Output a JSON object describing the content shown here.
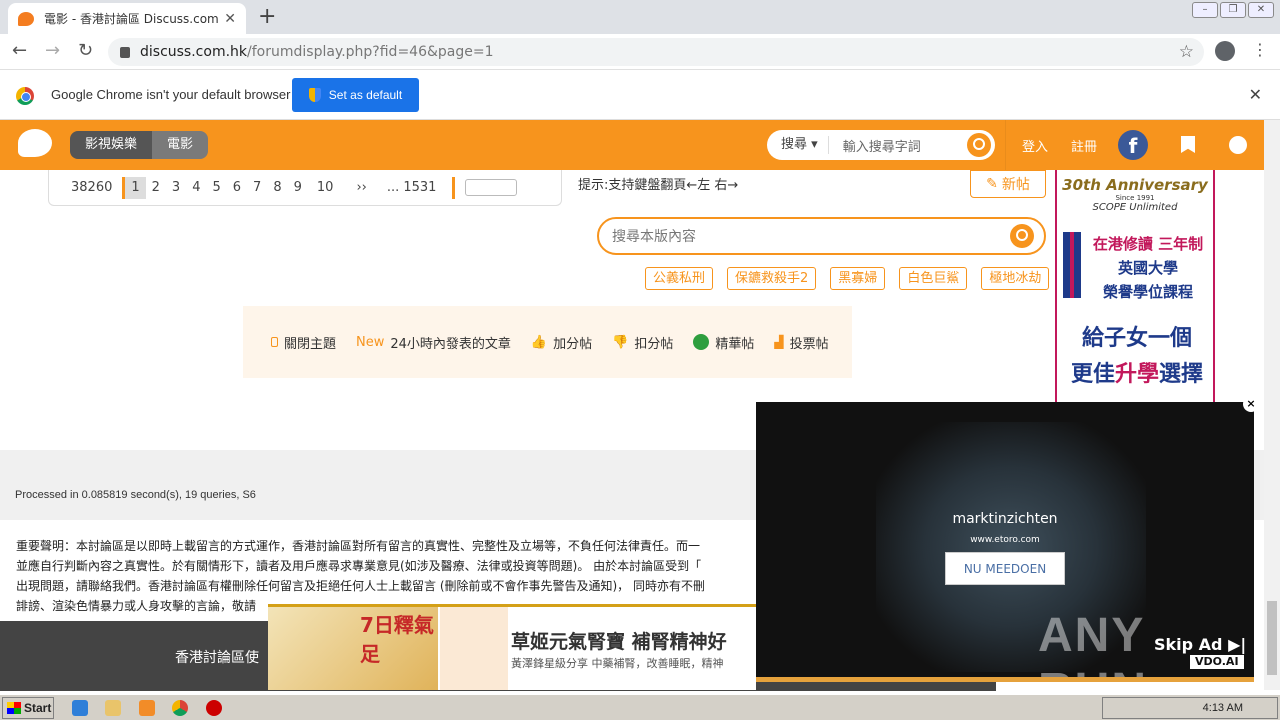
{
  "browser": {
    "tab_title": "電影 - 香港討論區 Discuss.com.hk -",
    "url_host": "discuss.com.hk",
    "url_path": "/forumdisplay.php?fid=46&page=1",
    "infobar_message": "Google Chrome isn't your default browser",
    "set_default_label": "Set as default"
  },
  "header": {
    "crumb1": "影視娛樂",
    "crumb2": "電影",
    "search_select": "搜尋",
    "search_placeholder": "輸入搜尋字詞",
    "login": "登入",
    "register": "註冊",
    "fb_glyph": "f"
  },
  "pager": {
    "total": "38260",
    "pages": [
      "1",
      "2",
      "3",
      "4",
      "5",
      "6",
      "7",
      "8",
      "9",
      "10",
      "››",
      "... 1531"
    ],
    "current": "1"
  },
  "hint": "提示:支持鍵盤翻頁←左 右→",
  "new_post_label": "新帖",
  "forum_search_placeholder": "搜尋本版內容",
  "tags": [
    "公義私刑",
    "保鑣救殺手2",
    "黑寡婦",
    "白色巨鯊",
    "極地冰劫"
  ],
  "legend": {
    "closed": "關閉主題",
    "new_badge": "New",
    "new_text": "24小時內發表的文章",
    "plus": "加分帖",
    "minus": "扣分帖",
    "digest": "精華帖",
    "poll": "投票帖"
  },
  "processed": "Processed in 0.085819 second(s), 19 queries, S6",
  "disclaimer": [
    "重要聲明：本討論區是以即時上載留言的方式運作，香港討論區對所有留言的真實性、完整性及立場等，不負任何法律責任。而一",
    "並應自行判斷內容之真實性。於有關情形下，讀者及用戶應尋求專業意見(如涉及醫療、法律或投資等問題)。 由於本討論區受到「",
    "出現問題，請聯絡我們。香港討論區有權刪除任何留言及拒絕任何人士上載留言 (刪除前或不會作事先警告及通知)， 同時亦有不刪",
    "誹謗、渲染色情暴力或人身攻擊的言論，敬請"
  ],
  "footer_text": "香港討論區使",
  "side_ad": {
    "anniv": "30th Anniversary",
    "since": "Since 1991",
    "brand": "SCOPE Unlimited",
    "line1": "在港修讀 三年制",
    "line2": "英國大學",
    "line3": "榮譽學位課程",
    "line4": "給子女一個",
    "line5a": "更佳",
    "line5b": "升學",
    "line5c": "選擇"
  },
  "video_ad": {
    "title": "marktinzichten",
    "site": "www.etoro.com",
    "cta": "NU MEEDOEN",
    "skip": "Skip Ad ▶|",
    "vdo": "VDO.AI",
    "watermark": "ANY RUN",
    "close": "×"
  },
  "bottom_ad": {
    "badge": "7日釋氣足",
    "headline": "草姬元氣腎寶 補腎精神好",
    "sub": "黃澤鋒星級分享 中藥補腎，改善睡眠，精神"
  },
  "taskbar": {
    "start": "Start",
    "time": "4:13 AM"
  },
  "colors": {
    "brand_orange": "#f7941d",
    "chrome_blue": "#1a73e8"
  }
}
